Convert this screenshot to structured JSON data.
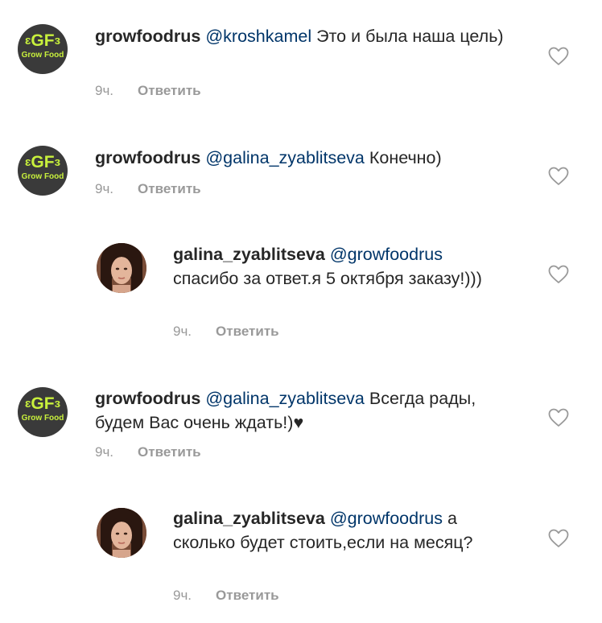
{
  "comments": [
    {
      "username": "growfoodrus",
      "mention": "@kroshkamel",
      "text": " Это и была наша цель)",
      "time": "9ч.",
      "reply_label": "Ответить",
      "avatar": "growfood-logo",
      "indented": false
    },
    {
      "username": "growfoodrus",
      "mention": "@galina_zyablitseva",
      "text": "Конечно)",
      "time": "9ч.",
      "reply_label": "Ответить",
      "avatar": "growfood-logo",
      "indented": false
    },
    {
      "username": "galina_zyablitseva",
      "mention": "@growfoodrus",
      "text": "спасибо за ответ.я 5 октября заказу!)))",
      "time": "9ч.",
      "reply_label": "Ответить",
      "avatar": "user-photo",
      "indented": true
    },
    {
      "username": "growfoodrus",
      "mention": "@galina_zyablitseva",
      "text": "Всегда рады, будем Вас очень ждать!)♥",
      "time": "9ч.",
      "reply_label": "Ответить",
      "avatar": "growfood-logo",
      "indented": false
    },
    {
      "username": "galina_zyablitseva",
      "mention": "@growfoodrus",
      "text": "а сколько будет стоить,если на месяц?",
      "time": "9ч.",
      "reply_label": "Ответить",
      "avatar": "user-photo",
      "indented": true
    }
  ],
  "logo": {
    "main": "GF",
    "sub": "Grow Food"
  },
  "colors": {
    "text": "#262626",
    "mention": "#003569",
    "meta": "#999999",
    "logo_bg": "#3a3a3a",
    "logo_accent": "#c8f03c"
  },
  "icons": {
    "like": "heart-outline-icon"
  }
}
